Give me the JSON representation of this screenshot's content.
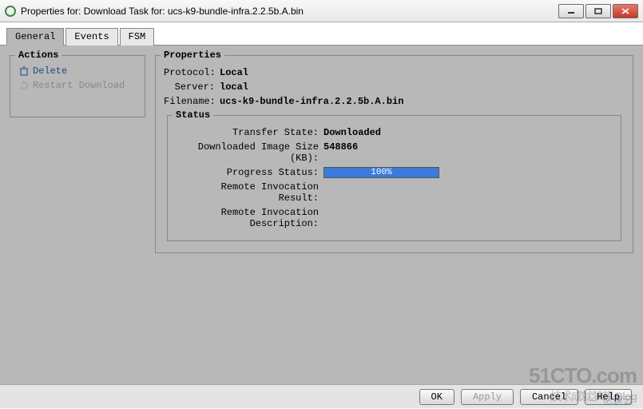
{
  "window": {
    "title": "Properties for: Download Task for: ucs-k9-bundle-infra.2.2.5b.A.bin"
  },
  "tabs": {
    "general": "General",
    "events": "Events",
    "fsm": "FSM",
    "active": "general"
  },
  "actions": {
    "title": "Actions",
    "delete": "Delete",
    "restart": "Restart Download"
  },
  "properties": {
    "title": "Properties",
    "protocol": {
      "label": "Protocol:",
      "value": "Local"
    },
    "server": {
      "label": "Server:",
      "value": "local"
    },
    "filename": {
      "label": "Filename:",
      "value": "ucs-k9-bundle-infra.2.2.5b.A.bin"
    }
  },
  "status": {
    "title": "Status",
    "transfer_state": {
      "label": "Transfer State:",
      "value": "Downloaded"
    },
    "downloaded_size": {
      "label": "Downloaded Image Size (KB):",
      "value": "548866"
    },
    "progress": {
      "label": "Progress Status:",
      "value": "100%"
    },
    "remote_result": {
      "label": "Remote Invocation Result:",
      "value": ""
    },
    "remote_desc": {
      "label": "Remote Invocation Description:",
      "value": ""
    }
  },
  "buttons": {
    "ok": "OK",
    "apply": "Apply",
    "cancel": "Cancel",
    "help": "Help"
  },
  "watermark": {
    "main": "51CTO.com",
    "sub": "技术成就梦想  Blog",
    "secondary": "亿速云"
  }
}
